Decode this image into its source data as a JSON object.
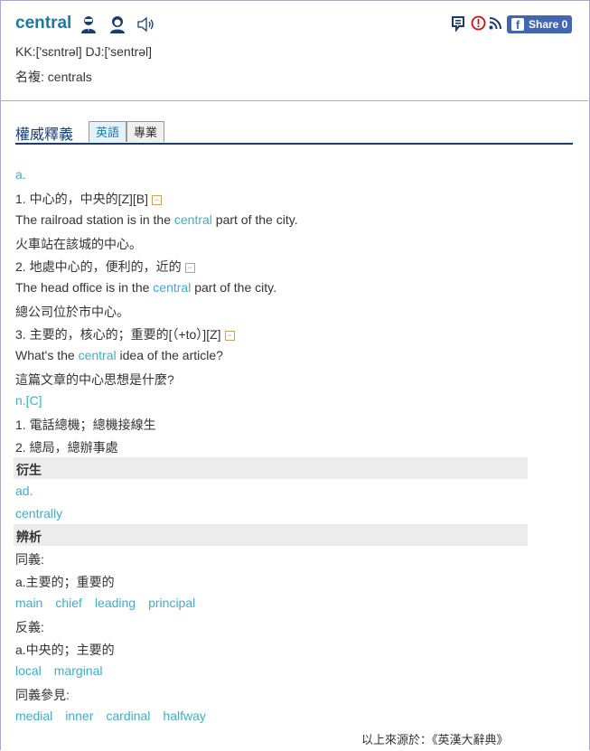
{
  "header": {
    "word": "central",
    "pronunciation": "KK:['sɛntrəl]  DJ:['sentrəl]",
    "plural": "名複: centrals",
    "share_label": "Share 0",
    "icons": [
      "male-voice-icon",
      "female-voice-icon",
      "speaker-icon",
      "vocabulary-add-icon",
      "report-icon",
      "rss-icon",
      "facebook-icon"
    ]
  },
  "section": {
    "title": "權威釋義",
    "tabs": [
      "英語",
      "專業"
    ],
    "active_tab": "英語"
  },
  "entry": {
    "pos_adj": "a.",
    "sense1": "1. 中心的，中央的[Z][B]",
    "ex1_before": "The railroad station is in the ",
    "ex1_word": "central",
    "ex1_after": " part of the city.",
    "ex1_trans": "火車站在該城的中心。",
    "sense2": "2. 地處中心的，便利的，近的",
    "ex2_before": "The head office is in the ",
    "ex2_word": "central",
    "ex2_after": " part of the city.",
    "ex2_trans": "總公司位於市中心。",
    "sense3": "3. 主要的，核心的；重要的[（+to）][Z]",
    "ex3_before": "What's the ",
    "ex3_word": "central",
    "ex3_after": " idea of the article?",
    "ex3_trans": "這篇文章的中心思想是什麼?",
    "pos_noun": "n.[C]",
    "noun1": "1. 電話總機；總機接線生",
    "noun2": "2. 總局，總辦事處"
  },
  "derivatives": {
    "heading": "衍生",
    "pos": "ad.",
    "word": "centrally"
  },
  "analysis": {
    "heading": "辨析",
    "synonym_label": "同義:",
    "synonym_sense": "a.主要的；重要的",
    "synonyms": [
      "main",
      "chief",
      "leading",
      "principal"
    ],
    "antonym_label": "反義:",
    "antonym_sense": "a.中央的；主要的",
    "antonyms": [
      "local",
      "marginal"
    ],
    "see_also_label": "同義參見:",
    "see_also": [
      "medial",
      "inner",
      "cardinal",
      "halfway"
    ]
  },
  "footer": {
    "source": "以上來源於：《英漢大辭典》"
  },
  "colors": {
    "link": "#3ab0c8",
    "title": "#1a7aa6",
    "rule": "#1a3d6e",
    "band": "#ececec",
    "fb": "#4267b2"
  }
}
